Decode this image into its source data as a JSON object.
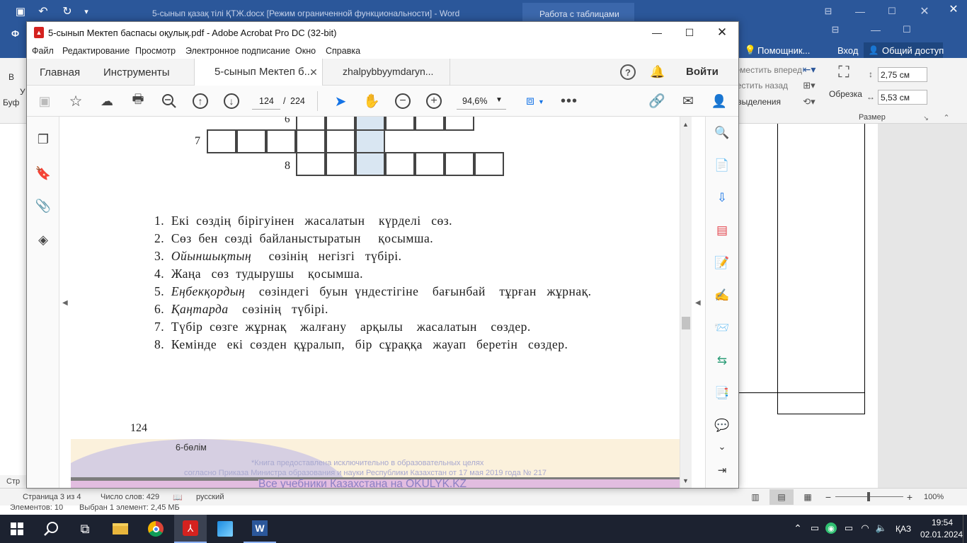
{
  "word": {
    "title": "5-сынып қазақ тілі ҚТЖ.docx [Режим ограниченной функциональности] - Word",
    "tables_context": "Работа с таблицами",
    "tell_me": "Помощник...",
    "sign_in": "Вход",
    "share": "Общий доступ",
    "ribbon_bring_forward": "Переместить вперед",
    "ribbon_send_backward": "Переместить назад",
    "ribbon_selection": "Область выделения",
    "ribbon_crop": "Обрезка",
    "height_value": "2,75 см",
    "width_value": "5,53 см",
    "size_group": "Размер",
    "left_cut_labels": [
      "Ф",
      "В",
      "У",
      "Буф",
      "Стр"
    ],
    "status": {
      "page": "Страница 3 из 4",
      "words": "Число слов: 429",
      "language": "русский",
      "zoom": "100%"
    }
  },
  "explorer_status": {
    "items": "Элементов: 10",
    "selected": "Выбран 1 элемент: 2,45 МБ"
  },
  "acrobat": {
    "title": "5-сынып Мектеп баспасы оқулық.pdf - Adobe Acrobat Pro DC (32-bit)",
    "menu": [
      "Файл",
      "Редактирование",
      "Просмотр",
      "Электронное подписание",
      "Окно",
      "Справка"
    ],
    "tabs": {
      "home": "Главная",
      "tools": "Инструменты",
      "doc1": "5-сынып Мектеп б...",
      "doc2": "zhalpybbyymdaryn...",
      "signin": "Войти"
    },
    "toolbar": {
      "page_current": "124",
      "page_sep": "/",
      "page_total": "224",
      "zoom": "94,6%"
    }
  },
  "pdf_page": {
    "crossword_labels": {
      "r6": "6",
      "r7": "7",
      "r8": "8"
    },
    "questions": [
      "1.  Екі  сөздің  бірігуінен   жасалатын    күрделі   сөз.",
      "2.  Сөз  бен  сөзді  байланыстыратын     қосымша.",
      "3.  ",
      "4.  Жаңа   сөз  тудырушы    қосымша.",
      "5.  ",
      "6.  ",
      "7.  Түбір  сөзге  жұрнақ    жалғану    арқылы    жасалатын    сөздер.",
      "8.  Кемінде   екі  сөзден  құралып,   бір  сұраққа   жауап   беретін   сөздер."
    ],
    "q3_italic": "Ойыншықтың",
    "q3_rest": "     сөзінің   негізгі   түбірі.",
    "q5_italic": "Еңбекқордың",
    "q5_rest": "    сөзіндегі   буын  үндестігіне    бағынбай    тұрған   жұрнақ.",
    "q6_italic": "Қаңтарда",
    "q6_rest": "    сөзінің   түбірі.",
    "page_number": "124",
    "section": "6-бөлім",
    "watermark_1": "*Книга предоставлена исключительно в образовательных целях",
    "watermark_2": "согласно Приказа Министра образования и науки Республики Казахстан от 17 мая 2019 года № 217",
    "watermark_3": "Все учебники Казахстана на OKULYK.KZ"
  },
  "taskbar": {
    "time": "19:54",
    "date": "02.01.2024",
    "lang": "ҚАЗ"
  },
  "colors": {
    "word_blue": "#2b579a",
    "acrobat_red": "#d4221f",
    "taskbar": "#1c2230",
    "highlight_cell": "#d9e6f2"
  }
}
